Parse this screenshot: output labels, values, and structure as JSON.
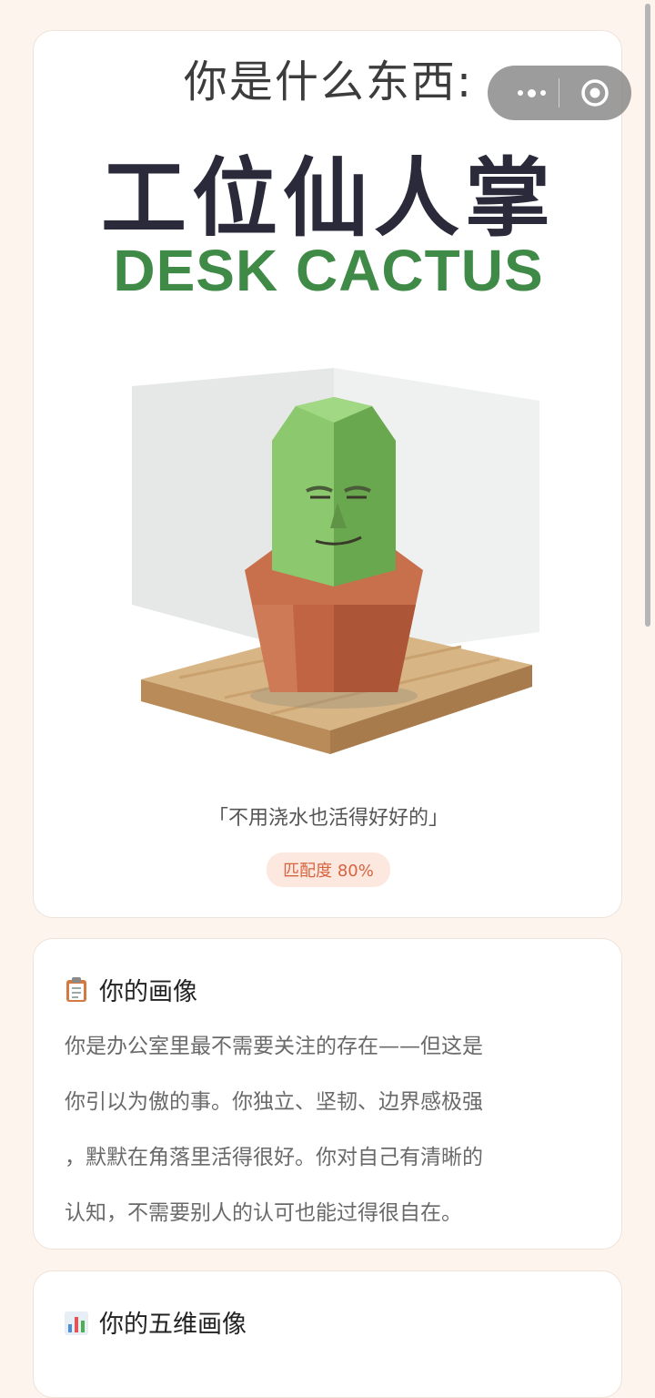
{
  "result": {
    "question": "你是什么东西:",
    "name_cn": "工位仙人掌",
    "name_en": "DESK CACTUS",
    "illustration": "low-poly-cactus-in-terracotta-pot",
    "quote": "「不用浇水也活得好好的」",
    "match_label": "匹配度 80%",
    "match_percent": 80
  },
  "portrait": {
    "icon": "clipboard-emoji",
    "title": "你的画像",
    "lines": [
      "你是办公室里最不需要关注的存在——但这是",
      "你引以为傲的事。你独立、坚韧、边界感极强",
      "，默默在角落里活得很好。你对自己有清晰的",
      "认知，不需要别人的认可也能过得很自在。"
    ]
  },
  "five_dim": {
    "icon": "bar-chart-emoji",
    "title": "你的五维画像"
  },
  "capsule": {
    "more_icon": "more-dots-icon",
    "close_icon": "target-close-icon"
  },
  "colors": {
    "page_bg": "#fdf4ee",
    "title_dark": "#2a2a3a",
    "english_green": "#3f8a46",
    "match_text": "#d5643f",
    "match_bg": "#fde8e0"
  }
}
